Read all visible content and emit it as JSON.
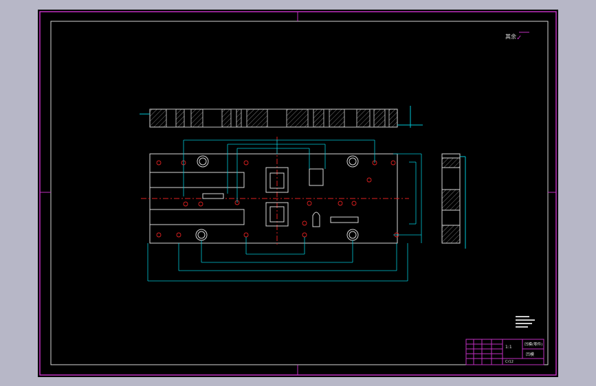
{
  "colors": {
    "background": "#b7b7c7",
    "sheet": "#000000",
    "border": "#c030c0",
    "outline": "#d8d8d8",
    "dimension": "#00c8d8",
    "centerline": "#e02020",
    "hatch": "#a0a0a0",
    "text": "#e0e0e0"
  },
  "drawing": {
    "roughness_label": "其余",
    "roughness_symbol": "✓"
  },
  "title_block": {
    "name_label": "凹模",
    "drawing_number": "凹模(零件)",
    "scale": "1:1",
    "material": "Cr12"
  }
}
